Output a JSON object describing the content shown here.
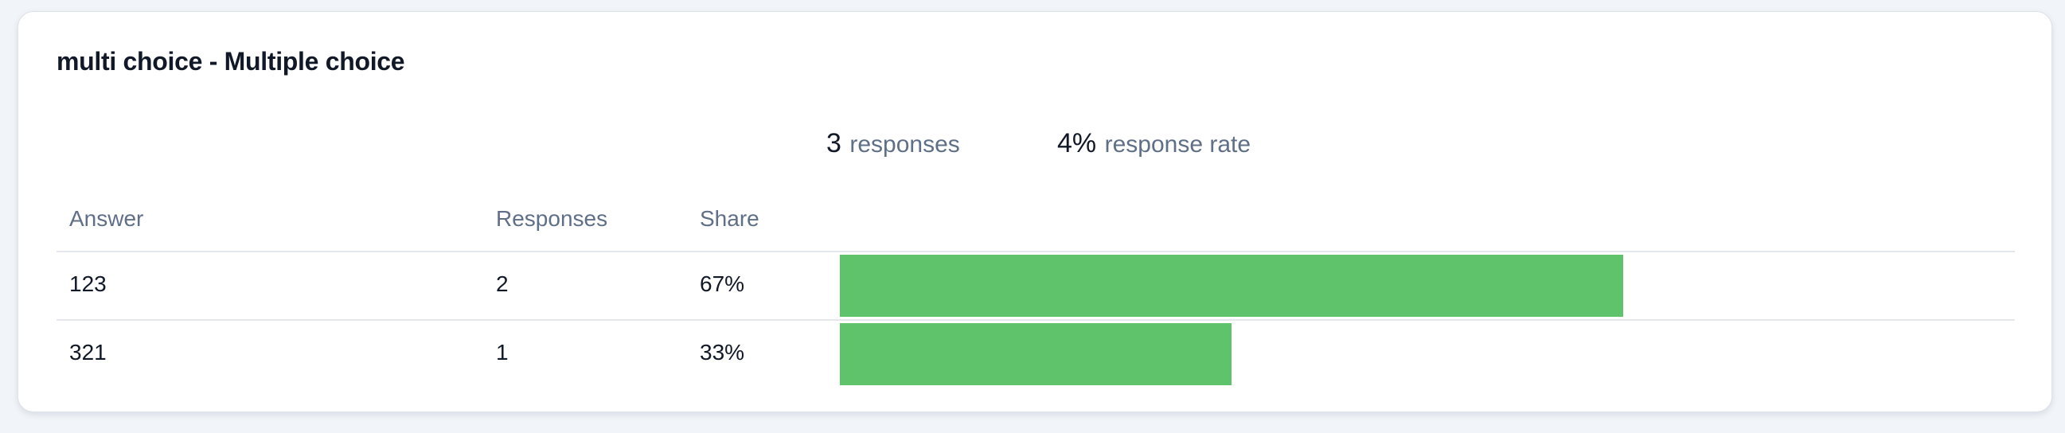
{
  "question": {
    "title": "multi choice - Multiple choice"
  },
  "stats": {
    "responses_value": "3",
    "responses_label": "responses",
    "rate_value": "4%",
    "rate_label": "response rate"
  },
  "table": {
    "headers": {
      "answer": "Answer",
      "responses": "Responses",
      "share": "Share"
    },
    "rows": [
      {
        "answer": "123",
        "responses": "2",
        "share": "67%",
        "share_fraction": 0.667
      },
      {
        "answer": "321",
        "responses": "1",
        "share": "33%",
        "share_fraction": 0.333
      }
    ]
  },
  "colors": {
    "bar": "#5ec36a"
  }
}
